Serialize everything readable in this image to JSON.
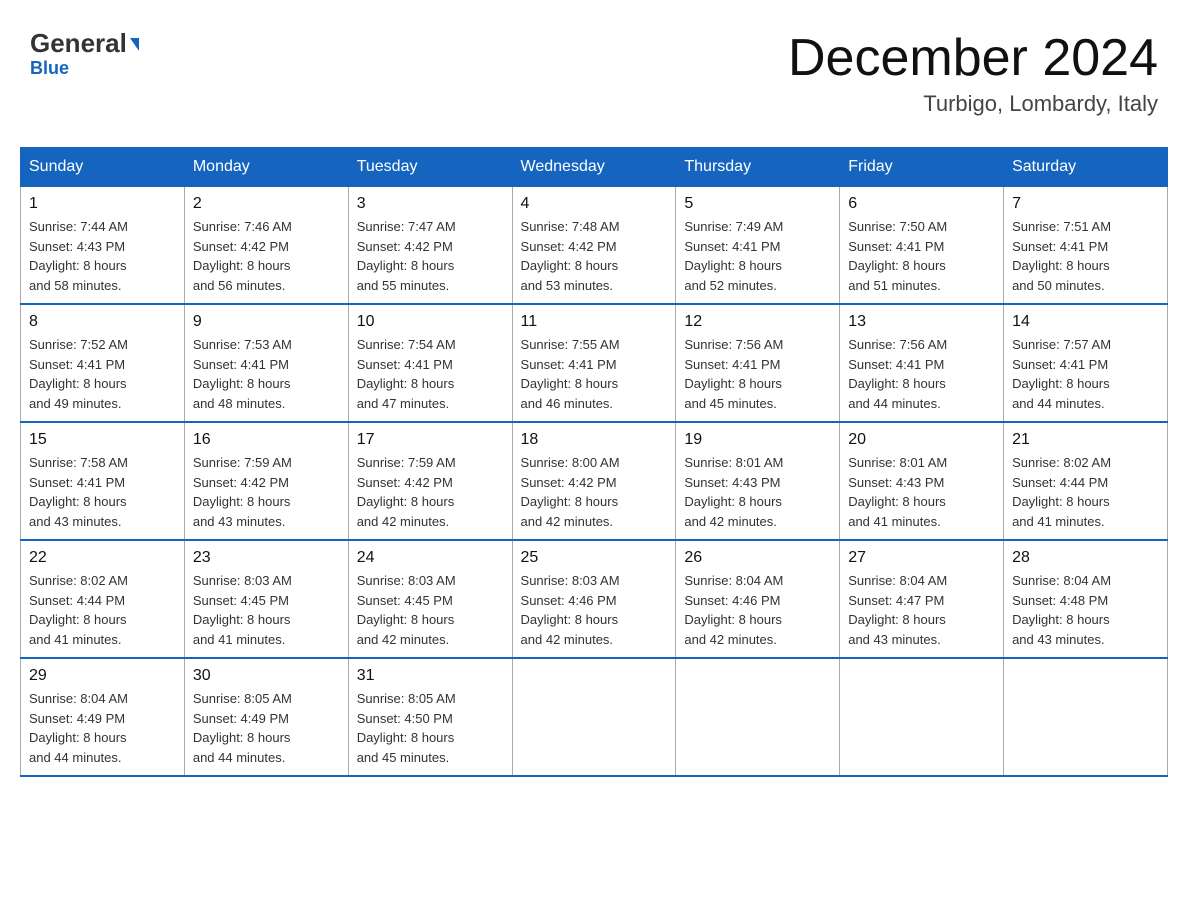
{
  "header": {
    "logo_top": "General",
    "logo_arrow": "▶",
    "logo_bottom": "Blue",
    "month_title": "December 2024",
    "location": "Turbigo, Lombardy, Italy"
  },
  "days_of_week": [
    "Sunday",
    "Monday",
    "Tuesday",
    "Wednesday",
    "Thursday",
    "Friday",
    "Saturday"
  ],
  "weeks": [
    [
      {
        "day": "1",
        "sunrise": "7:44 AM",
        "sunset": "4:43 PM",
        "daylight": "8 hours and 58 minutes."
      },
      {
        "day": "2",
        "sunrise": "7:46 AM",
        "sunset": "4:42 PM",
        "daylight": "8 hours and 56 minutes."
      },
      {
        "day": "3",
        "sunrise": "7:47 AM",
        "sunset": "4:42 PM",
        "daylight": "8 hours and 55 minutes."
      },
      {
        "day": "4",
        "sunrise": "7:48 AM",
        "sunset": "4:42 PM",
        "daylight": "8 hours and 53 minutes."
      },
      {
        "day": "5",
        "sunrise": "7:49 AM",
        "sunset": "4:41 PM",
        "daylight": "8 hours and 52 minutes."
      },
      {
        "day": "6",
        "sunrise": "7:50 AM",
        "sunset": "4:41 PM",
        "daylight": "8 hours and 51 minutes."
      },
      {
        "day": "7",
        "sunrise": "7:51 AM",
        "sunset": "4:41 PM",
        "daylight": "8 hours and 50 minutes."
      }
    ],
    [
      {
        "day": "8",
        "sunrise": "7:52 AM",
        "sunset": "4:41 PM",
        "daylight": "8 hours and 49 minutes."
      },
      {
        "day": "9",
        "sunrise": "7:53 AM",
        "sunset": "4:41 PM",
        "daylight": "8 hours and 48 minutes."
      },
      {
        "day": "10",
        "sunrise": "7:54 AM",
        "sunset": "4:41 PM",
        "daylight": "8 hours and 47 minutes."
      },
      {
        "day": "11",
        "sunrise": "7:55 AM",
        "sunset": "4:41 PM",
        "daylight": "8 hours and 46 minutes."
      },
      {
        "day": "12",
        "sunrise": "7:56 AM",
        "sunset": "4:41 PM",
        "daylight": "8 hours and 45 minutes."
      },
      {
        "day": "13",
        "sunrise": "7:56 AM",
        "sunset": "4:41 PM",
        "daylight": "8 hours and 44 minutes."
      },
      {
        "day": "14",
        "sunrise": "7:57 AM",
        "sunset": "4:41 PM",
        "daylight": "8 hours and 44 minutes."
      }
    ],
    [
      {
        "day": "15",
        "sunrise": "7:58 AM",
        "sunset": "4:41 PM",
        "daylight": "8 hours and 43 minutes."
      },
      {
        "day": "16",
        "sunrise": "7:59 AM",
        "sunset": "4:42 PM",
        "daylight": "8 hours and 43 minutes."
      },
      {
        "day": "17",
        "sunrise": "7:59 AM",
        "sunset": "4:42 PM",
        "daylight": "8 hours and 42 minutes."
      },
      {
        "day": "18",
        "sunrise": "8:00 AM",
        "sunset": "4:42 PM",
        "daylight": "8 hours and 42 minutes."
      },
      {
        "day": "19",
        "sunrise": "8:01 AM",
        "sunset": "4:43 PM",
        "daylight": "8 hours and 42 minutes."
      },
      {
        "day": "20",
        "sunrise": "8:01 AM",
        "sunset": "4:43 PM",
        "daylight": "8 hours and 41 minutes."
      },
      {
        "day": "21",
        "sunrise": "8:02 AM",
        "sunset": "4:44 PM",
        "daylight": "8 hours and 41 minutes."
      }
    ],
    [
      {
        "day": "22",
        "sunrise": "8:02 AM",
        "sunset": "4:44 PM",
        "daylight": "8 hours and 41 minutes."
      },
      {
        "day": "23",
        "sunrise": "8:03 AM",
        "sunset": "4:45 PM",
        "daylight": "8 hours and 41 minutes."
      },
      {
        "day": "24",
        "sunrise": "8:03 AM",
        "sunset": "4:45 PM",
        "daylight": "8 hours and 42 minutes."
      },
      {
        "day": "25",
        "sunrise": "8:03 AM",
        "sunset": "4:46 PM",
        "daylight": "8 hours and 42 minutes."
      },
      {
        "day": "26",
        "sunrise": "8:04 AM",
        "sunset": "4:46 PM",
        "daylight": "8 hours and 42 minutes."
      },
      {
        "day": "27",
        "sunrise": "8:04 AM",
        "sunset": "4:47 PM",
        "daylight": "8 hours and 43 minutes."
      },
      {
        "day": "28",
        "sunrise": "8:04 AM",
        "sunset": "4:48 PM",
        "daylight": "8 hours and 43 minutes."
      }
    ],
    [
      {
        "day": "29",
        "sunrise": "8:04 AM",
        "sunset": "4:49 PM",
        "daylight": "8 hours and 44 minutes."
      },
      {
        "day": "30",
        "sunrise": "8:05 AM",
        "sunset": "4:49 PM",
        "daylight": "8 hours and 44 minutes."
      },
      {
        "day": "31",
        "sunrise": "8:05 AM",
        "sunset": "4:50 PM",
        "daylight": "8 hours and 45 minutes."
      },
      null,
      null,
      null,
      null
    ]
  ],
  "labels": {
    "sunrise": "Sunrise: ",
    "sunset": "Sunset: ",
    "daylight": "Daylight: "
  }
}
